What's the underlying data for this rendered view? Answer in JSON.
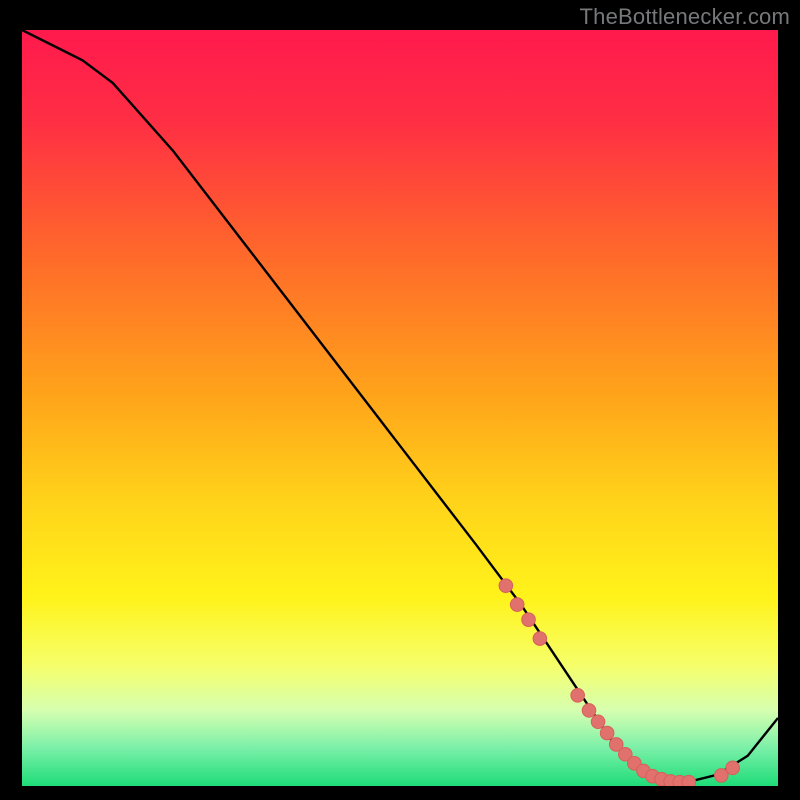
{
  "attribution": "TheBottlenecker.com",
  "colors": {
    "gradient_stops": [
      {
        "offset": 0.0,
        "color": "#ff1a4d"
      },
      {
        "offset": 0.12,
        "color": "#ff2e44"
      },
      {
        "offset": 0.3,
        "color": "#ff6a2a"
      },
      {
        "offset": 0.48,
        "color": "#ffa31a"
      },
      {
        "offset": 0.62,
        "color": "#ffd21a"
      },
      {
        "offset": 0.75,
        "color": "#fff31a"
      },
      {
        "offset": 0.84,
        "color": "#f6ff6a"
      },
      {
        "offset": 0.9,
        "color": "#d6ffb0"
      },
      {
        "offset": 0.95,
        "color": "#7af0a8"
      },
      {
        "offset": 1.0,
        "color": "#1edc78"
      }
    ],
    "curve_stroke": "#000000",
    "dot_fill": "#e0716c",
    "dot_stroke": "#d85f59"
  },
  "chart_data": {
    "type": "line",
    "title": "",
    "xlabel": "",
    "ylabel": "",
    "xlim": [
      0,
      100
    ],
    "ylim": [
      0,
      100
    ],
    "series": [
      {
        "name": "curve",
        "x": [
          0,
          4,
          8,
          12,
          20,
          30,
          40,
          50,
          60,
          66,
          70,
          74,
          78,
          80,
          82,
          84,
          86,
          88,
          92,
          96,
          100
        ],
        "y": [
          100,
          98,
          96,
          93,
          84,
          71,
          58,
          45,
          32,
          24,
          18,
          12,
          6,
          4,
          2,
          1,
          0.5,
          0.5,
          1.5,
          4,
          9
        ]
      }
    ],
    "dots": {
      "name": "highlighted-points",
      "x": [
        64,
        65.5,
        67,
        68.5,
        73.5,
        75,
        76.2,
        77.4,
        78.6,
        79.8,
        81,
        82.2,
        83.4,
        84.6,
        85.8,
        87,
        88.2,
        92.5,
        94
      ],
      "y": [
        26.5,
        24,
        22,
        19.5,
        12,
        10,
        8.5,
        7,
        5.5,
        4.2,
        3,
        2,
        1.3,
        0.9,
        0.6,
        0.5,
        0.5,
        1.4,
        2.4
      ]
    }
  }
}
